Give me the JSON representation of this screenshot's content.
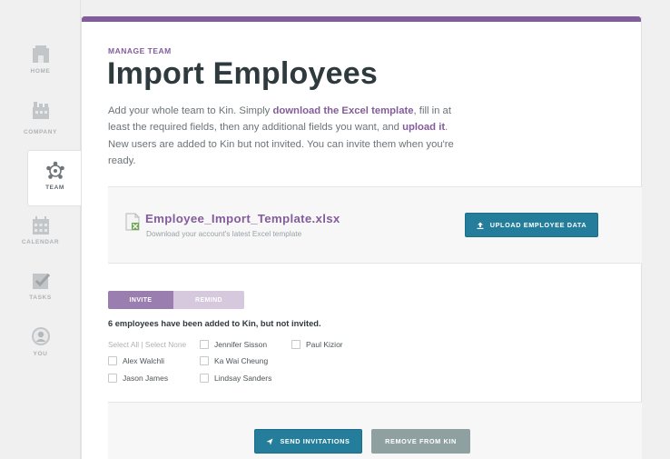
{
  "sidebar": {
    "items": [
      {
        "label": "HOME",
        "icon": "home-icon",
        "active": false
      },
      {
        "label": "COMPANY",
        "icon": "company-icon",
        "active": false
      },
      {
        "label": "TEAM",
        "icon": "team-icon",
        "active": true
      },
      {
        "label": "CALENDAR",
        "icon": "calendar-icon",
        "active": false
      },
      {
        "label": "TASKS",
        "icon": "tasks-icon",
        "active": false
      },
      {
        "label": "YOU",
        "icon": "avatar-icon",
        "active": false
      }
    ]
  },
  "header": {
    "overline": "MANAGE TEAM",
    "title": "Import Employees"
  },
  "description": {
    "part1": "Add your whole team to Kin. Simply ",
    "link1": "download the Excel template",
    "part2": ", fill in at least the required fields, then any additional fields you want, and ",
    "link2": "upload it",
    "part3": ". New users are added to Kin but not invited. You can invite them when you're ready."
  },
  "template": {
    "file_name": "Employee_Import_Template.xlsx",
    "subtitle": "Download your account's latest Excel template",
    "upload_label": "UPLOAD EMPLOYEE DATA"
  },
  "tabs": [
    {
      "label": "INVITE",
      "active": true
    },
    {
      "label": "REMIND",
      "active": false
    }
  ],
  "invite": {
    "notice": "6 employees have been added to Kin, but not invited.",
    "select_all": "Select All",
    "separator": "|",
    "select_none": "Select None",
    "employees": [
      "Jennifer Sisson",
      "Paul Kizior",
      "Alex Walchli",
      "Ka Wai Cheung",
      "Jason James",
      "Lindsay Sanders"
    ]
  },
  "actions": {
    "send_label": "SEND INVITATIONS",
    "remove_label": "REMOVE FROM KIN"
  },
  "colors": {
    "brand_purple": "#835c9c",
    "primary_button": "#247e9b",
    "secondary_button": "#8fa0a0"
  }
}
